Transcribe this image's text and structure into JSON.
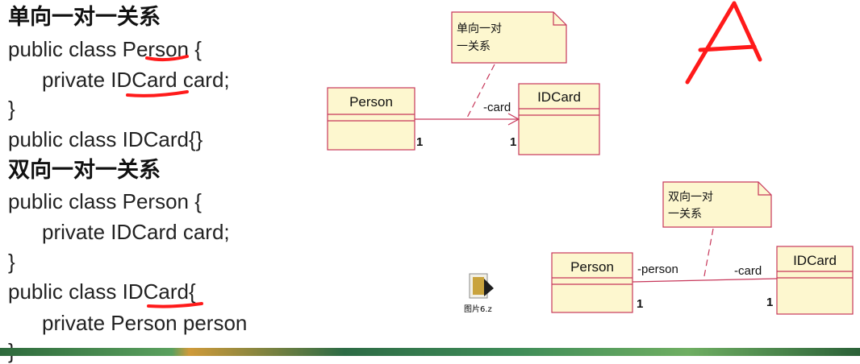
{
  "code": {
    "one_way_heading": "单向一对一关系",
    "l1": "public class Person {",
    "l2": "private IDCard card;",
    "l3": "}",
    "l4": "public class IDCard{}",
    "two_way_heading": "双向一对一关系",
    "l5": "public class Person {",
    "l6": "private IDCard card;",
    "l7": "}",
    "l8": "public class IDCard{",
    "l9": "private Person person",
    "l10": "}"
  },
  "diagram_one_way": {
    "note": [
      "单向一对",
      "一关系"
    ],
    "class_left": "Person",
    "class_right": "IDCard",
    "role": "-card",
    "mult_left": "1",
    "mult_right": "1"
  },
  "diagram_two_way": {
    "note": [
      "双向一对",
      "一关系"
    ],
    "class_left": "Person",
    "class_right": "IDCard",
    "role_left": "-person",
    "role_right": "-card",
    "mult_left": "1",
    "mult_right": "1"
  },
  "file": {
    "label": "图片6.z"
  },
  "handwritten_mark": "A",
  "colors": {
    "uml_fill": "#fdf7cf",
    "uml_stroke": "#c7375a",
    "note_fill": "#fdf7cf",
    "annotation": "#ff1a1a"
  }
}
